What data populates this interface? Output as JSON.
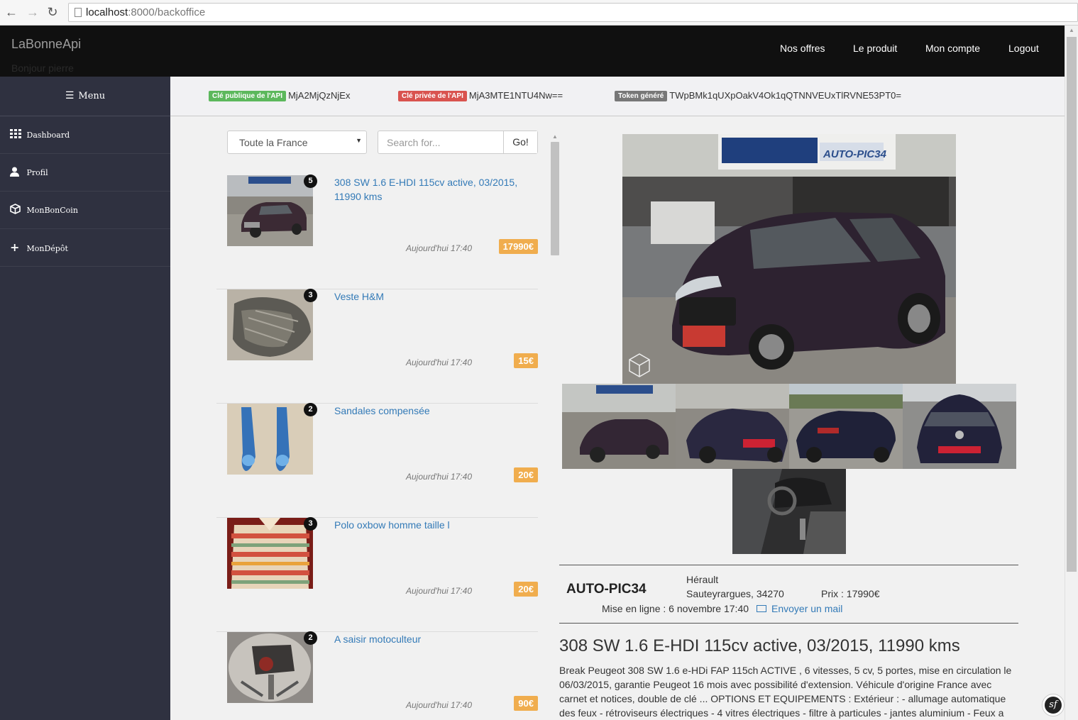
{
  "browser": {
    "url_host": "localhost",
    "url_rest": ":8000/backoffice"
  },
  "navbar": {
    "brand": "LaBonneApi",
    "greeting": "Bonjour pierre",
    "links": [
      "Nos offres",
      "Le produit",
      "Mon compte",
      "Logout"
    ]
  },
  "sidebar": {
    "menu_label": "Menu",
    "items": [
      {
        "label": "Dashboard",
        "icon": "grid-icon"
      },
      {
        "label": "Profil",
        "icon": "user-icon"
      },
      {
        "label": "MonBonCoin",
        "icon": "cube-icon"
      },
      {
        "label": "MonDépôt",
        "icon": "plus-icon"
      }
    ]
  },
  "api_keys": {
    "public": {
      "label": "Clé publique de l'API",
      "value": "MjA2MjQzNjEx",
      "color": "#5cb85c"
    },
    "private": {
      "label": "Clé privée de l'API",
      "value": "MjA3MTE1NTU4Nw==",
      "color": "#d9534f"
    },
    "token": {
      "label": "Token généré",
      "value": "TWpBMk1qUXpOakV4Ok1qQTNNVEUxTlRVNE53PT0=",
      "color": "#777777"
    }
  },
  "filters": {
    "region_selected": "Toute la France",
    "search_placeholder": "Search for...",
    "go_label": "Go!"
  },
  "listings": [
    {
      "title": "308 SW 1.6 E-HDI 115cv active, 03/2015, 11990 kms",
      "date": "Aujourd'hui 17:40",
      "price": "17990€",
      "photos": "5"
    },
    {
      "title": "Veste H&M",
      "date": "Aujourd'hui 17:40",
      "price": "15€",
      "photos": "3"
    },
    {
      "title": "Sandales compensée",
      "date": "Aujourd'hui 17:40",
      "price": "20€",
      "photos": "2"
    },
    {
      "title": "Polo oxbow homme taille l",
      "date": "Aujourd'hui 17:40",
      "price": "20€",
      "photos": "3"
    },
    {
      "title": "A saisir motoculteur",
      "date": "Aujourd'hui 17:40",
      "price": "90€",
      "photos": "2"
    }
  ],
  "detail": {
    "main_photo_banner": "AUTO-PIC34",
    "seller": "AUTO-PIC34",
    "region": "Hérault",
    "city": "Sauteyrargues, 34270",
    "price": "Prix : 17990€",
    "online": "Mise en ligne : 6 novembre 17:40",
    "mail": "Envoyer un mail",
    "title": "308 SW 1.6 E-HDI 115cv active, 03/2015, 11990 kms",
    "description": "Break Peugeot 308 SW 1.6 e-HDi FAP 115ch ACTIVE , 6 vitesses, 5 cv, 5 portes, mise en circulation le 06/03/2015, garantie Peugeot 16 mois avec possibilité d'extension. Véhicule d'origine France avec carnet et notices, double de clé ... OPTIONS ET EQUIPEMENTS : Extérieur : - allumage automatique des feux - rétroviseurs électriques - 4 vitres électriques - filtre à particules - jantes aluminium - Feux a"
  },
  "sf_toolbar": "sf"
}
